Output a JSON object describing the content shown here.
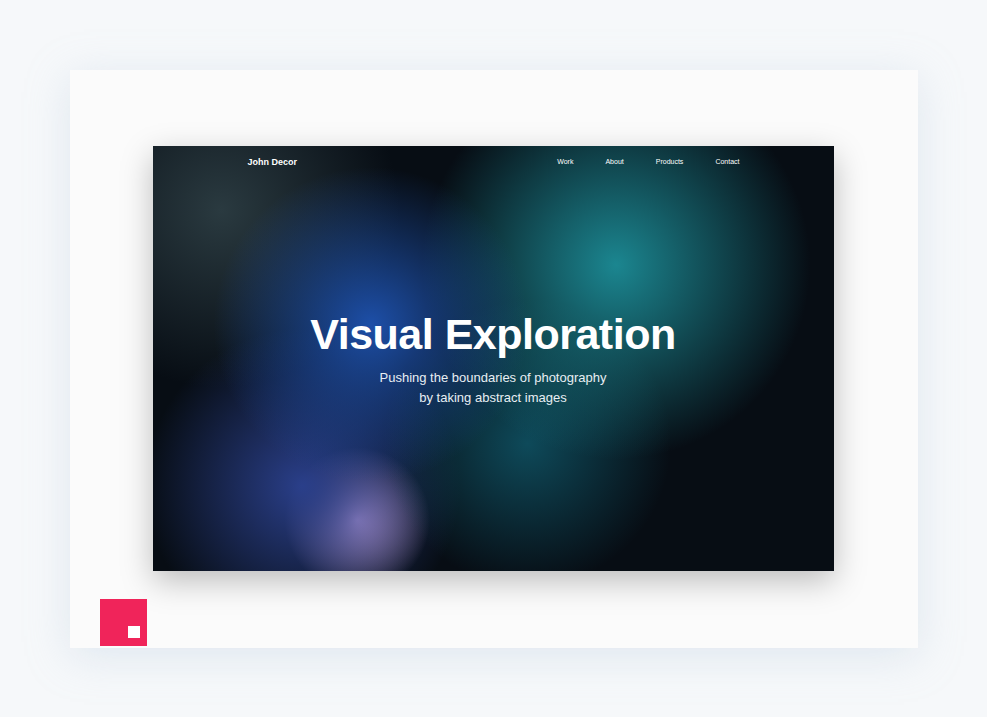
{
  "site": {
    "brand": "John Decor",
    "nav": [
      {
        "label": "Work"
      },
      {
        "label": "About"
      },
      {
        "label": "Products"
      },
      {
        "label": "Contact"
      }
    ]
  },
  "hero": {
    "title": "Visual Exploration",
    "subtitle": [
      "Pushing the boundaries of photography",
      "by taking abstract images"
    ]
  }
}
